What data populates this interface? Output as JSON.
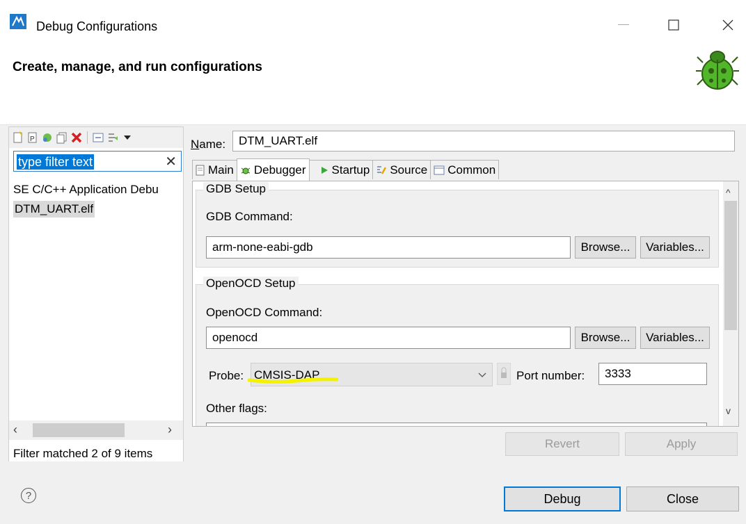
{
  "window": {
    "title": "Debug Configurations"
  },
  "header": {
    "title": "Create, manage, and run configurations"
  },
  "left": {
    "filter_placeholder": "type filter text",
    "tree": [
      "SE C/C++ Application Debu",
      "DTM_UART.elf"
    ],
    "status": "Filter matched 2 of 9 items"
  },
  "right": {
    "name_label": "Name:",
    "name_value": "DTM_UART.elf",
    "tabs": [
      "Main",
      "Debugger",
      "Startup",
      "Source",
      "Common"
    ],
    "gdb": {
      "group": "GDB Setup",
      "label": "GDB Command:",
      "value": "arm-none-eabi-gdb",
      "browse": "Browse...",
      "variables": "Variables..."
    },
    "openocd": {
      "group": "OpenOCD Setup",
      "label": "OpenOCD Command:",
      "value": "openocd",
      "browse": "Browse...",
      "variables": "Variables...",
      "probe_label": "Probe:",
      "probe_value": "CMSIS-DAP",
      "port_label": "Port number:",
      "port_value": "3333",
      "other_flags": "Other flags:"
    },
    "revert": "Revert",
    "apply": "Apply"
  },
  "footer": {
    "debug": "Debug",
    "close": "Close"
  },
  "colors": {
    "accent": "#0078d7",
    "highlight": "#f5f200",
    "bug": "#4caf2a"
  }
}
